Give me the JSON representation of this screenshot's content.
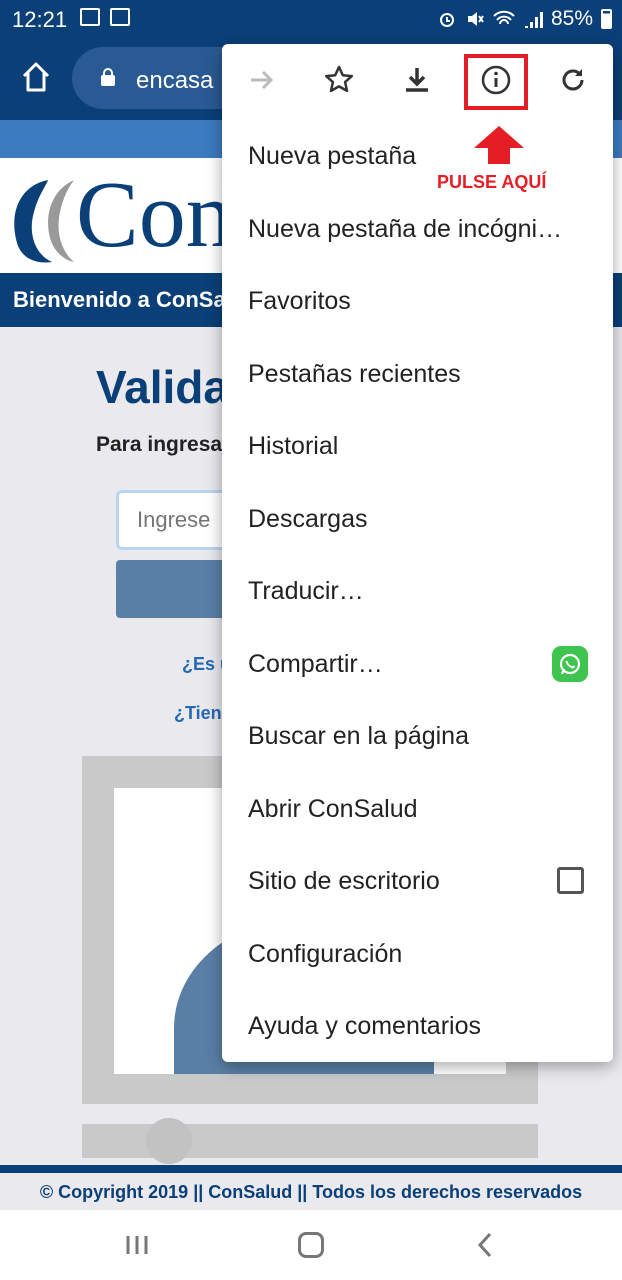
{
  "status_bar": {
    "time": "12:21",
    "battery": "85%",
    "icons": [
      "image-icon",
      "voicemail-icon",
      "alarm-icon",
      "mute-icon",
      "wifi-icon",
      "signal-icon",
      "battery-icon"
    ]
  },
  "browser": {
    "url": "encasa"
  },
  "page": {
    "logo_text": "Con",
    "welcome": "Bienvenido a ConSa",
    "heading": "Valida",
    "subtitle": "Para ingresa",
    "input_placeholder": "Ingrese",
    "link_1": "¿Es u",
    "link_2": "¿Tien",
    "footer": "© Copyright 2019 || ConSalud || Todos los derechos reservados"
  },
  "menu": {
    "toolbar_icons": [
      "forward-icon",
      "star-icon",
      "download-icon",
      "info-icon",
      "reload-icon"
    ],
    "callout": "PULSE AQUÍ",
    "items": [
      {
        "label": "Nueva pestaña"
      },
      {
        "label": "Nueva pestaña de incógni…"
      },
      {
        "label": "Favoritos"
      },
      {
        "label": "Pestañas recientes"
      },
      {
        "label": "Historial"
      },
      {
        "label": "Descargas"
      },
      {
        "label": "Traducir…"
      },
      {
        "label": "Compartir…"
      },
      {
        "label": "Buscar en la página"
      },
      {
        "label": "Abrir ConSalud"
      },
      {
        "label": "Sitio de escritorio"
      },
      {
        "label": "Configuración"
      },
      {
        "label": "Ayuda y comentarios"
      }
    ]
  },
  "colors": {
    "brand_blue": "#0a3f78",
    "highlight_red": "#e51e26",
    "whatsapp_green": "#3fc44f"
  }
}
